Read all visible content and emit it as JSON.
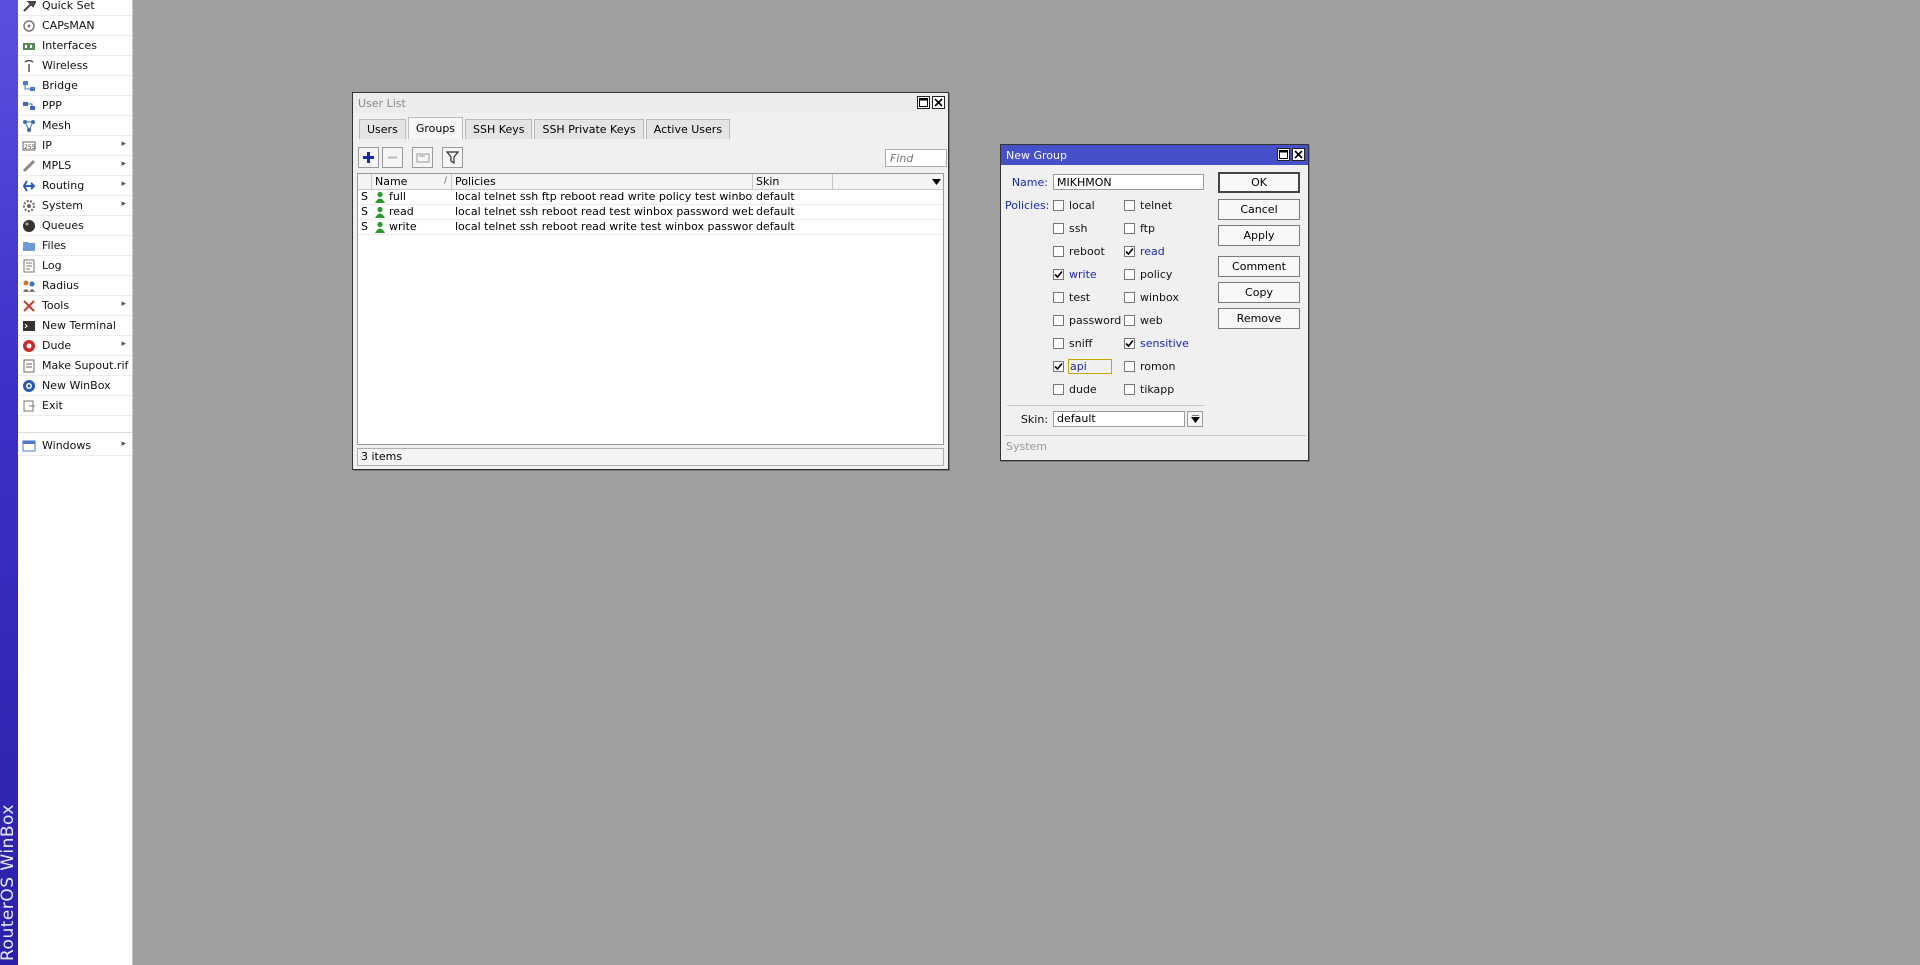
{
  "app": {
    "brand": "RouterOS WinBox"
  },
  "sidebar": {
    "items": [
      {
        "label": "Quick Set",
        "icon": "quick-set-icon",
        "submenu": false
      },
      {
        "label": "CAPsMAN",
        "icon": "capsman-icon",
        "submenu": false
      },
      {
        "label": "Interfaces",
        "icon": "interfaces-icon",
        "submenu": false
      },
      {
        "label": "Wireless",
        "icon": "wireless-icon",
        "submenu": false
      },
      {
        "label": "Bridge",
        "icon": "bridge-icon",
        "submenu": false
      },
      {
        "label": "PPP",
        "icon": "ppp-icon",
        "submenu": false
      },
      {
        "label": "Mesh",
        "icon": "mesh-icon",
        "submenu": false
      },
      {
        "label": "IP",
        "icon": "ip-icon",
        "submenu": true
      },
      {
        "label": "MPLS",
        "icon": "mpls-icon",
        "submenu": true
      },
      {
        "label": "Routing",
        "icon": "routing-icon",
        "submenu": true
      },
      {
        "label": "System",
        "icon": "system-gear-icon",
        "submenu": true
      },
      {
        "label": "Queues",
        "icon": "queues-icon",
        "submenu": false
      },
      {
        "label": "Files",
        "icon": "files-icon",
        "submenu": false
      },
      {
        "label": "Log",
        "icon": "log-icon",
        "submenu": false
      },
      {
        "label": "Radius",
        "icon": "radius-icon",
        "submenu": false
      },
      {
        "label": "Tools",
        "icon": "tools-icon",
        "submenu": true
      },
      {
        "label": "New Terminal",
        "icon": "terminal-icon",
        "submenu": false
      },
      {
        "label": "Dude",
        "icon": "dude-icon",
        "submenu": true
      },
      {
        "label": "Make Supout.rif",
        "icon": "supout-icon",
        "submenu": false
      },
      {
        "label": "New WinBox",
        "icon": "winbox-icon",
        "submenu": false
      },
      {
        "label": "Exit",
        "icon": "exit-icon",
        "submenu": false
      }
    ],
    "windows_item": {
      "label": "Windows",
      "icon": "windows-icon",
      "submenu": true
    }
  },
  "user_list": {
    "title": "User List",
    "tabs": [
      {
        "label": "Users",
        "active": false
      },
      {
        "label": "Groups",
        "active": true
      },
      {
        "label": "SSH Keys",
        "active": false
      },
      {
        "label": "SSH Private Keys",
        "active": false
      },
      {
        "label": "Active Users",
        "active": false
      }
    ],
    "find_placeholder": "Find",
    "columns": {
      "name": "Name",
      "policies": "Policies",
      "skin": "Skin"
    },
    "rows": [
      {
        "flag": "S",
        "name": "full",
        "policies": "local telnet ssh ftp reboot read write policy test winbox passw...",
        "skin": "default"
      },
      {
        "flag": "S",
        "name": "read",
        "policies": "local telnet ssh reboot read test winbox password web sniff s...",
        "skin": "default"
      },
      {
        "flag": "S",
        "name": "write",
        "policies": "local telnet ssh reboot read write test winbox password web ...",
        "skin": "default"
      }
    ],
    "status": "3 items"
  },
  "new_group": {
    "title": "New Group",
    "name_label": "Name:",
    "name_value": "MIKHMON",
    "policies_label": "Policies:",
    "policies": [
      {
        "label": "local",
        "checked": false
      },
      {
        "label": "telnet",
        "checked": false
      },
      {
        "label": "ssh",
        "checked": false
      },
      {
        "label": "ftp",
        "checked": false
      },
      {
        "label": "reboot",
        "checked": false
      },
      {
        "label": "read",
        "checked": true
      },
      {
        "label": "write",
        "checked": true
      },
      {
        "label": "policy",
        "checked": false
      },
      {
        "label": "test",
        "checked": false
      },
      {
        "label": "winbox",
        "checked": false
      },
      {
        "label": "password",
        "checked": false
      },
      {
        "label": "web",
        "checked": false
      },
      {
        "label": "sniff",
        "checked": false
      },
      {
        "label": "sensitive",
        "checked": true
      },
      {
        "label": "api",
        "checked": true
      },
      {
        "label": "romon",
        "checked": false
      },
      {
        "label": "dude",
        "checked": false
      },
      {
        "label": "tikapp",
        "checked": false
      }
    ],
    "skin_label": "Skin:",
    "skin_value": "default",
    "buttons": {
      "ok": "OK",
      "cancel": "Cancel",
      "apply": "Apply",
      "comment": "Comment",
      "copy": "Copy",
      "remove": "Remove"
    },
    "status": "System"
  },
  "colors": {
    "title_active": "#4650c8",
    "accent_blue": "#1a2ab0",
    "desktop": "#a0a0a0"
  }
}
